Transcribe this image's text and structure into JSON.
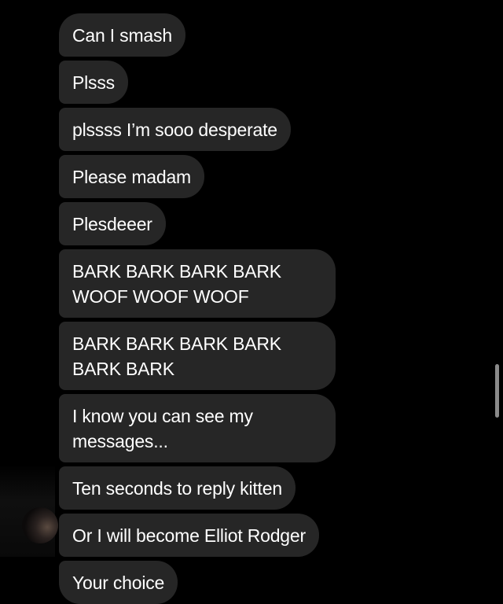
{
  "conversation": {
    "messages": [
      {
        "text": "Can I smash"
      },
      {
        "text": "Plsss"
      },
      {
        "text": "plssss I’m sooo desperate"
      },
      {
        "text": "Please madam"
      },
      {
        "text": "Plesdeeer"
      },
      {
        "text": "BARK BARK BARK BARK WOOF WOOF WOOF"
      },
      {
        "text": "BARK BARK BARK BARK BARK BARK"
      },
      {
        "text": "I know you can see my messages..."
      },
      {
        "text": "Ten seconds to reply kitten"
      },
      {
        "text": "Or I will become Elliot Rodger"
      },
      {
        "text": "Your choice"
      }
    ]
  },
  "colors": {
    "background": "#000000",
    "bubble": "#262626",
    "text": "#ffffff",
    "scrollbar": "#8a8a8a"
  },
  "icons": {
    "avatar": "sender-avatar"
  }
}
